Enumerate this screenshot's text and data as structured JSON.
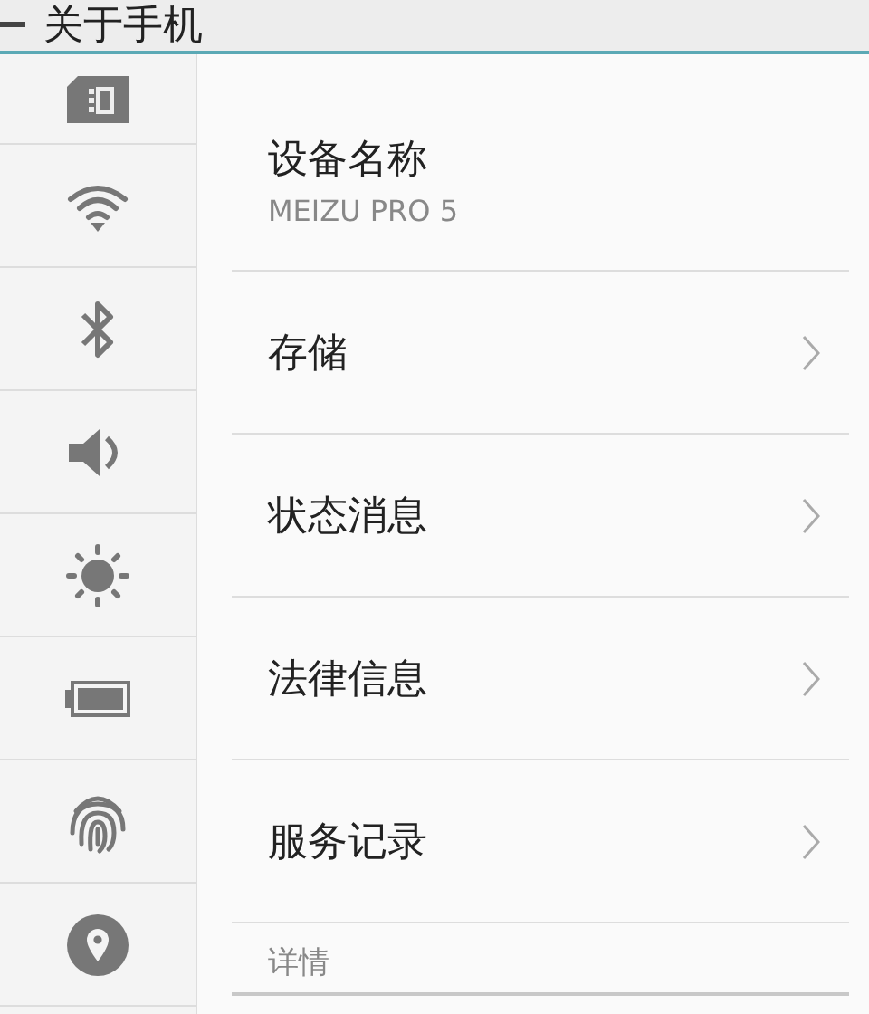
{
  "header": {
    "title": "关于手机"
  },
  "sidebar": {
    "items": [
      {
        "kind": "sim"
      },
      {
        "kind": "wifi"
      },
      {
        "kind": "bluetooth"
      },
      {
        "kind": "sound"
      },
      {
        "kind": "brightness"
      },
      {
        "kind": "battery"
      },
      {
        "kind": "fingerprint"
      },
      {
        "kind": "location"
      }
    ]
  },
  "device": {
    "label": "设备名称",
    "value": "MEIZU PRO 5"
  },
  "items": [
    {
      "label": "存储"
    },
    {
      "label": "状态消息"
    },
    {
      "label": "法律信息"
    },
    {
      "label": "服务记录"
    }
  ],
  "section": {
    "title": "详情"
  }
}
